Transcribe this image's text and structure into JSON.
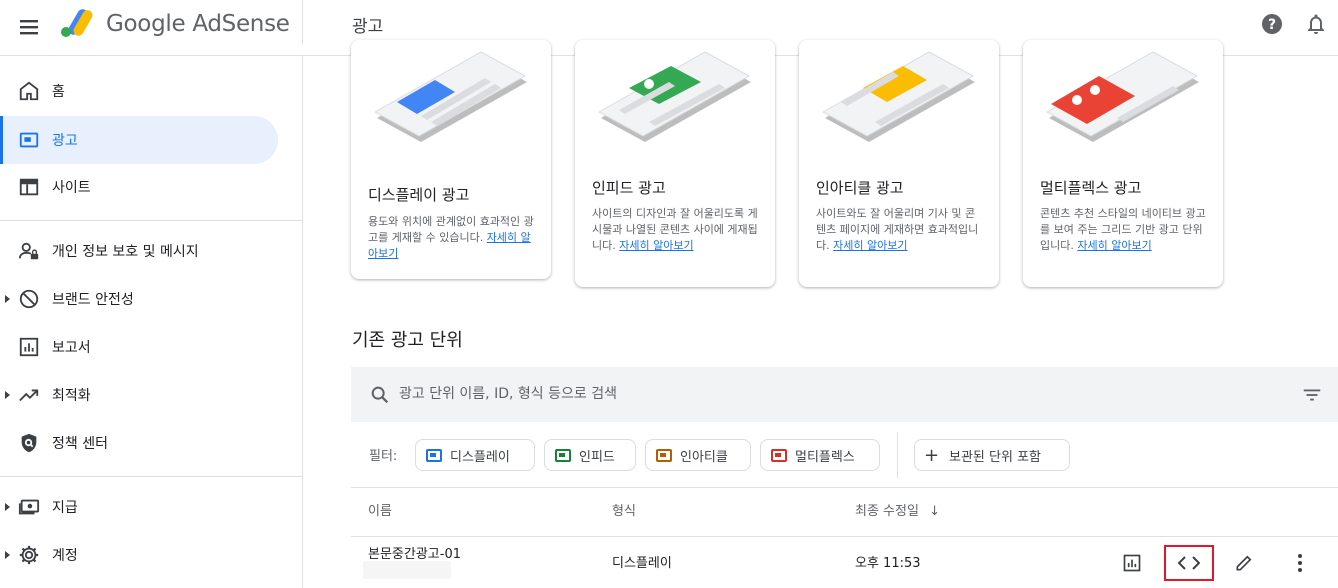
{
  "header": {
    "brand": "Google AdSense",
    "page_title": "광고"
  },
  "sidebar": {
    "items": [
      {
        "label": "홈",
        "icon": "home-icon"
      },
      {
        "label": "광고",
        "icon": "ads-icon",
        "active": true
      },
      {
        "label": "사이트",
        "icon": "sites-icon"
      },
      {
        "label": "개인 정보 보호 및 메시지",
        "icon": "privacy-icon"
      },
      {
        "label": "브랜드 안전성",
        "icon": "block-icon"
      },
      {
        "label": "보고서",
        "icon": "reports-icon"
      },
      {
        "label": "최적화",
        "icon": "trending-icon"
      },
      {
        "label": "정책 센터",
        "icon": "policy-icon"
      },
      {
        "label": "지급",
        "icon": "payments-icon"
      },
      {
        "label": "계정",
        "icon": "settings-icon"
      }
    ]
  },
  "cards": [
    {
      "title": "디스플레이 광고",
      "desc": "용도와 위치에 관계없이 효과적인 광고를 게재할 수 있습니다.",
      "link": "자세히 알아보기",
      "color": "#4285f4"
    },
    {
      "title": "인피드 광고",
      "desc": "사이트의 디자인과 잘 어울리도록 게시물과 나열된 콘텐츠 사이에 게재됩니다.",
      "link": "자세히 알아보기",
      "color": "#34a853"
    },
    {
      "title": "인아티클 광고",
      "desc": "사이트와도 잘 어울리며 기사 및 콘텐츠 페이지에 게재하면 효과적입니다.",
      "link": "자세히 알아보기",
      "color": "#fbbc04"
    },
    {
      "title": "멀티플렉스 광고",
      "desc": "콘텐츠 추천 스타일의 네이티브 광고를 보여 주는 그리드 기반 광고 단위입니다.",
      "link": "자세히 알아보기",
      "color": "#ea4335"
    }
  ],
  "existing": {
    "title": "기존 광고 단위",
    "search_placeholder": "광고 단위 이름, ID, 형식 등으로 검색",
    "filter_label": "필터:",
    "chips": [
      {
        "label": "디스플레이",
        "color": "#1a73e8"
      },
      {
        "label": "인피드",
        "color": "#188038"
      },
      {
        "label": "인아티클",
        "color": "#b06000"
      },
      {
        "label": "멀티플렉스",
        "color": "#d93025"
      }
    ],
    "archived_chip": "보관된 단위 포함",
    "columns": {
      "name": "이름",
      "type": "형식",
      "modified": "최종 수정일"
    },
    "rows": [
      {
        "name": "본문중간광고-01",
        "type": "디스플레이",
        "modified": "오후 11:53"
      }
    ]
  }
}
